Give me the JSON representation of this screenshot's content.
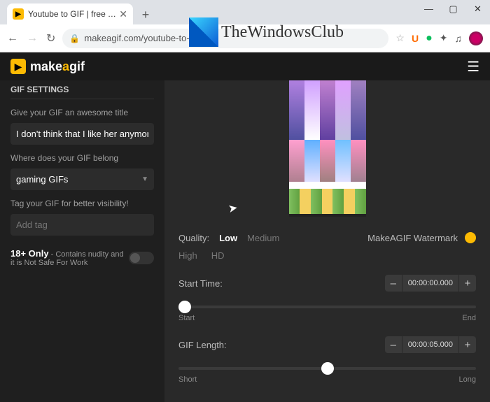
{
  "browser": {
    "tab_title": "Youtube to GIF | free YouTube to",
    "url": "makeagif.com/youtube-to-gif",
    "win_min": "—",
    "win_max": "▢",
    "win_close": "✕",
    "newtab": "+",
    "tab_close": "✕",
    "back": "←",
    "forward": "→",
    "reload": "↻",
    "lock": "🔒",
    "star": "☆",
    "ext_u": "U",
    "ext_g": "●",
    "ext_puzzle": "✦",
    "ext_music": "♫"
  },
  "overlay": {
    "text": "TheWindowsClub"
  },
  "app": {
    "logo_text_pre": "make",
    "logo_text_a": "a",
    "logo_text_post": "gif",
    "logo_icon": "▶",
    "menu_icon": "☰"
  },
  "sidebar": {
    "header": "GIF SETTINGS",
    "title_label": "Give your GIF an awesome title",
    "title_value": "I don't think that I like her anymore",
    "belong_label": "Where does your GIF belong",
    "belong_value": "gaming GIFs",
    "tag_label": "Tag your GIF for better visibility!",
    "tag_placeholder": "Add tag",
    "adult_bold": "18+ Only",
    "adult_rest": " - Contains nudity and it is Not Safe For Work"
  },
  "main": {
    "quality_label": "Quality:",
    "q_low": "Low",
    "q_med": "Medium",
    "q_high": "High",
    "q_hd": "HD",
    "watermark_label": "MakeAGIF Watermark",
    "start_label": "Start Time:",
    "start_value": "00:00:00.000",
    "start_left": "Start",
    "start_right": "End",
    "len_label": "GIF Length:",
    "len_value": "00:00:05.000",
    "len_left": "Short",
    "len_right": "Long",
    "minus": "–",
    "plus": "+"
  }
}
